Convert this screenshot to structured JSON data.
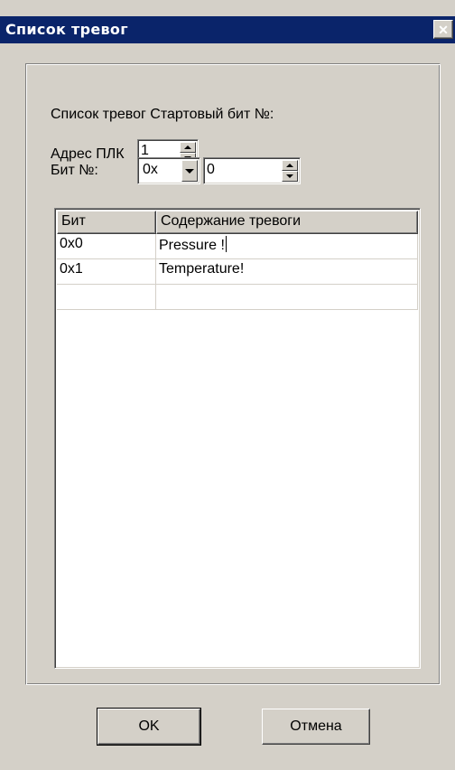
{
  "window": {
    "title": "Список тревог",
    "close_glyph": "✕"
  },
  "form": {
    "start_bit_label": "Список тревог Стартовый бит №:",
    "plc_address_label": "Адрес ПЛК",
    "plc_address_value": "1",
    "bit_label": "Бит №:",
    "bit_prefix_value": "0x",
    "bit_value": "0"
  },
  "table": {
    "columns": [
      "Бит",
      "Содержание тревоги"
    ],
    "rows": [
      {
        "bit": "0x0",
        "content": "Pressure !"
      },
      {
        "bit": "0x1",
        "content": "Temperature!"
      },
      {
        "bit": "",
        "content": ""
      }
    ]
  },
  "buttons": {
    "ok": "OK",
    "cancel": "Отмена"
  },
  "icons": [
    "close-icon",
    "spin-up-icon",
    "spin-down-icon",
    "dropdown-arrow-icon"
  ]
}
